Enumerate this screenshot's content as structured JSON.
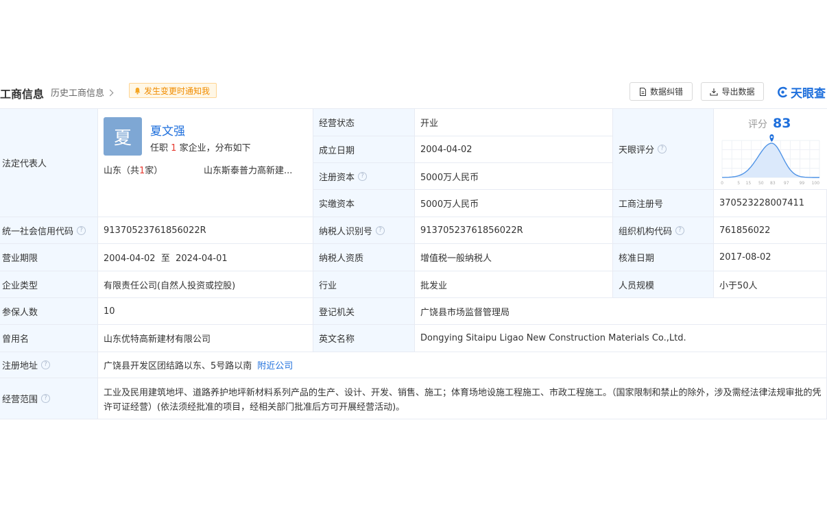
{
  "header": {
    "title": "工商信息",
    "history_link": "历史工商信息",
    "notify_label": "发生变更时通知我",
    "correct_button": "数据纠错",
    "export_button": "导出数据",
    "brand": "天眼查"
  },
  "legal_rep": {
    "label": "法定代表人",
    "avatar_char": "夏",
    "name": "夏文强",
    "sub_prefix": "任职",
    "sub_count": "1",
    "sub_suffix": "家企业，分布如下",
    "region_prefix": "山东（共",
    "region_count": "1",
    "region_suffix": "家）",
    "company": "山东斯泰普力高新建..."
  },
  "status": {
    "label": "经营状态",
    "value": "开业"
  },
  "founded": {
    "label": "成立日期",
    "value": "2004-04-02"
  },
  "reg_capital": {
    "label": "注册资本",
    "value": "5000万人民币"
  },
  "paid_capital": {
    "label": "实缴资本",
    "value": "5000万人民币"
  },
  "tianyan_score": {
    "label": "天眼评分",
    "score_label": "评分",
    "score": 83,
    "axis_ticks": [
      "0",
      "5",
      "15",
      "50",
      "83",
      "97",
      "99",
      "100"
    ]
  },
  "biz_reg_no": {
    "label": "工商注册号",
    "value": "370523228007411"
  },
  "credit_code": {
    "label": "统一社会信用代码",
    "value": "91370523761856022R"
  },
  "taxpayer_id": {
    "label": "纳税人识别号",
    "value": "91370523761856022R"
  },
  "org_code": {
    "label": "组织机构代码",
    "value": "761856022"
  },
  "term": {
    "label": "营业期限",
    "value": "2004-04-02  至  2024-04-01"
  },
  "taxpayer_qual": {
    "label": "纳税人资质",
    "value": "增值税一般纳税人"
  },
  "approve_date": {
    "label": "核准日期",
    "value": "2017-08-02"
  },
  "company_type": {
    "label": "企业类型",
    "value": "有限责任公司(自然人投资或控股)"
  },
  "industry": {
    "label": "行业",
    "value": "批发业"
  },
  "staff_size": {
    "label": "人员规模",
    "value": "小于50人"
  },
  "insured": {
    "label": "参保人数",
    "value": "10"
  },
  "reg_authority": {
    "label": "登记机关",
    "value": "广饶县市场监督管理局"
  },
  "former_name": {
    "label": "曾用名",
    "value": "山东优特高新建材有限公司"
  },
  "english_name": {
    "label": "英文名称",
    "value": "Dongying Sitaipu Ligao New Construction Materials Co.,Ltd."
  },
  "address": {
    "label": "注册地址",
    "value": "广饶县开发区团结路以东、5号路以南",
    "link": "附近公司"
  },
  "scope": {
    "label": "经营范围",
    "value": "工业及民用建筑地坪、道路养护地坪新材料系列产品的生产、设计、开发、销售、施工；体育场地设施工程施工、市政工程施工。（国家限制和禁止的除外，涉及需经法律法规审批的凭许可证经营）(依法须经批准的项目，经相关部门批准后方可开展经营活动)。"
  },
  "colors": {
    "label_bg": "#f2f8ff",
    "border": "#e7ebf3",
    "link": "#1e6fdc",
    "accent_red": "#e6382e",
    "notify_bg": "#fff7e6",
    "notify_text": "#f08c00"
  }
}
